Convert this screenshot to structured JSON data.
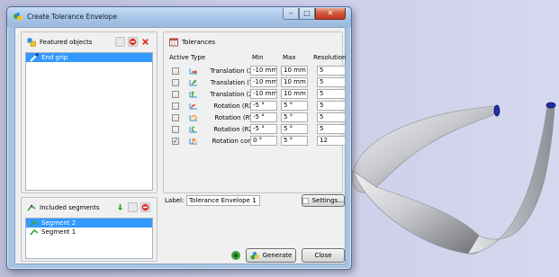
{
  "window": {
    "title": "Create Tolerance Envelope"
  },
  "featured": {
    "title": "Featured objects",
    "items": [
      {
        "label": "End grip",
        "selected": true
      }
    ]
  },
  "tolerances": {
    "title": "Tolerances",
    "columns": {
      "active": "Active",
      "type": "Type",
      "min": "Min",
      "max": "Max",
      "resolution": "Resolution"
    },
    "rows": [
      {
        "checked": false,
        "type": "Translation (X)",
        "min": "-10 mm",
        "max": "10 mm",
        "resolution": "5"
      },
      {
        "checked": false,
        "type": "Translation (Y)",
        "min": "-10 mm",
        "max": "10 mm",
        "resolution": "5"
      },
      {
        "checked": false,
        "type": "Translation (Z)",
        "min": "-10 mm",
        "max": "10 mm",
        "resolution": "5"
      },
      {
        "checked": false,
        "type": "Rotation (RX)",
        "min": "-5 °",
        "max": "5 °",
        "resolution": "5"
      },
      {
        "checked": false,
        "type": "Rotation (RY)",
        "min": "-5 °",
        "max": "5 °",
        "resolution": "5"
      },
      {
        "checked": false,
        "type": "Rotation (RZ)",
        "min": "-5 °",
        "max": "5 °",
        "resolution": "5"
      },
      {
        "checked": true,
        "type": "Rotation cone",
        "min": "0 °",
        "max": "5 °",
        "resolution": "12"
      }
    ],
    "check_mark": "✓"
  },
  "segments": {
    "title": "Included segments",
    "items": [
      {
        "label": "Segment 2",
        "selected": true
      },
      {
        "label": "Segment 1",
        "selected": false
      }
    ]
  },
  "label_field": {
    "caption": "Label:",
    "value": "Tolerance Envelope 1"
  },
  "buttons": {
    "settings": "Settings...",
    "generate": "Generate",
    "close": "Close"
  },
  "colors": {
    "accent": "#3399ff",
    "remove": "#d9352b",
    "add": "#3aa33a",
    "title": "#a8c3e3"
  }
}
